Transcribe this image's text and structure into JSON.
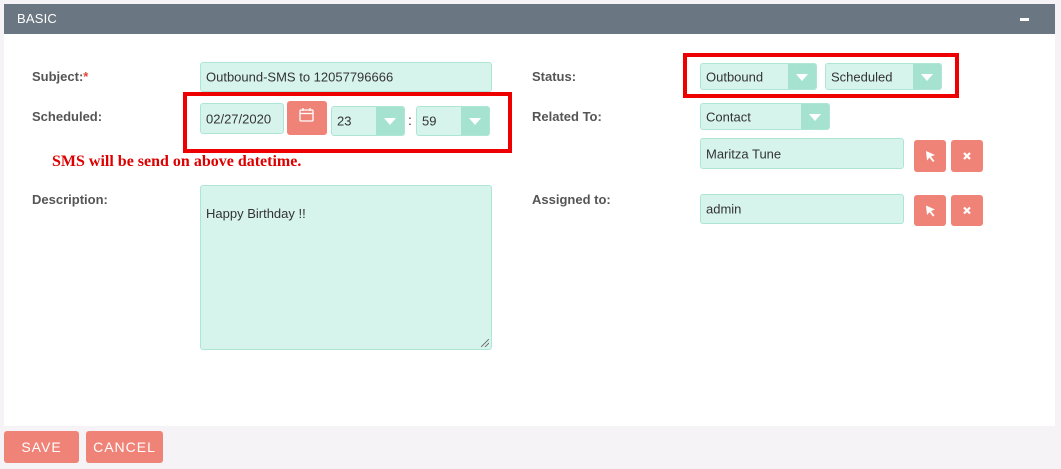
{
  "panel": {
    "title": "BASIC",
    "collapse_icon": "minus-icon"
  },
  "form": {
    "subject": {
      "label": "Subject:",
      "required_mark": "*",
      "value": "Outbound-SMS to  12057796666"
    },
    "scheduled": {
      "label": "Scheduled:",
      "date": "02/27/2020",
      "calendar_icon": "calendar-icon",
      "hour": "23",
      "separator": ":",
      "minute": "59"
    },
    "note": "SMS will be send on above datetime.",
    "description": {
      "label": "Description:",
      "value": "Happy Birthday !!"
    },
    "status": {
      "label": "Status:",
      "direction": "Outbound",
      "state": "Scheduled"
    },
    "related_to": {
      "label": "Related To:",
      "type": "Contact",
      "name": "Maritza Tune",
      "select_icon": "pointer-arrow-icon",
      "clear_icon": "close-icon"
    },
    "assigned_to": {
      "label": "Assigned to:",
      "name": "admin",
      "select_icon": "pointer-arrow-icon",
      "clear_icon": "close-icon"
    }
  },
  "footer": {
    "save_label": "SAVE",
    "cancel_label": "CANCEL"
  },
  "colors": {
    "accent": "#f08377",
    "field_bg": "#d7f4ec",
    "header_bg": "#6b7683",
    "highlight": "#ee0000"
  }
}
